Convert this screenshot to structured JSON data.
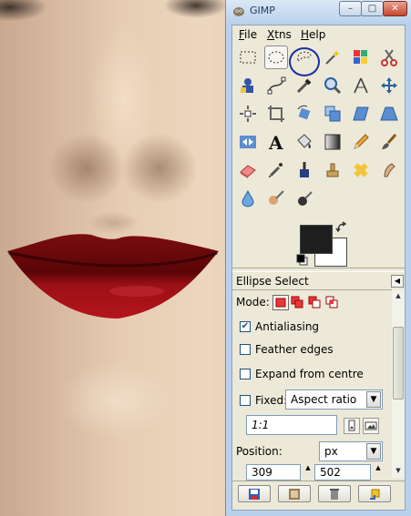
{
  "window": {
    "title": "GIMP",
    "controls": {
      "minimize": "–",
      "maximize": "□",
      "close": "✕"
    }
  },
  "menu": [
    {
      "label": "File",
      "mnemonic": "F"
    },
    {
      "label": "Xtns",
      "mnemonic": "X"
    },
    {
      "label": "Help",
      "mnemonic": "H"
    }
  ],
  "tools": [
    "rect-select-icon",
    "ellipse-select-icon",
    "free-select-icon",
    "fuzzy-select-icon",
    "select-by-color-icon",
    "scissors-icon",
    "foreground-select-icon",
    "paths-icon",
    "color-picker-icon",
    "zoom-icon",
    "measure-icon",
    "move-icon",
    "align-icon",
    "crop-icon",
    "rotate-icon",
    "scale-icon",
    "shear-icon",
    "perspective-icon",
    "flip-icon",
    "text-icon",
    "bucket-fill-icon",
    "blend-icon",
    "pencil-icon",
    "paintbrush-icon",
    "eraser-icon",
    "airbrush-icon",
    "ink-icon",
    "clone-icon",
    "heal-icon",
    "smudge-icon",
    "blur-icon",
    "dodge-burn-icon",
    "convolve-icon"
  ],
  "selected_tool": "ellipse-select-icon",
  "colors": {
    "foreground": "#1e1e1e",
    "background": "#ffffff"
  },
  "tool_options": {
    "title": "Ellipse Select",
    "mode_label": "Mode:",
    "antialiasing": {
      "label": "Antialiasing",
      "checked": true
    },
    "feather": {
      "label": "Feather edges",
      "checked": false
    },
    "expand": {
      "label": "Expand from centre",
      "checked": false
    },
    "fixed": {
      "label": "Fixed:",
      "checked": false,
      "value": "Aspect ratio"
    },
    "ratio_value": "1:1",
    "position": {
      "label": "Position:",
      "unit": "px",
      "x": "309",
      "y": "502"
    }
  }
}
